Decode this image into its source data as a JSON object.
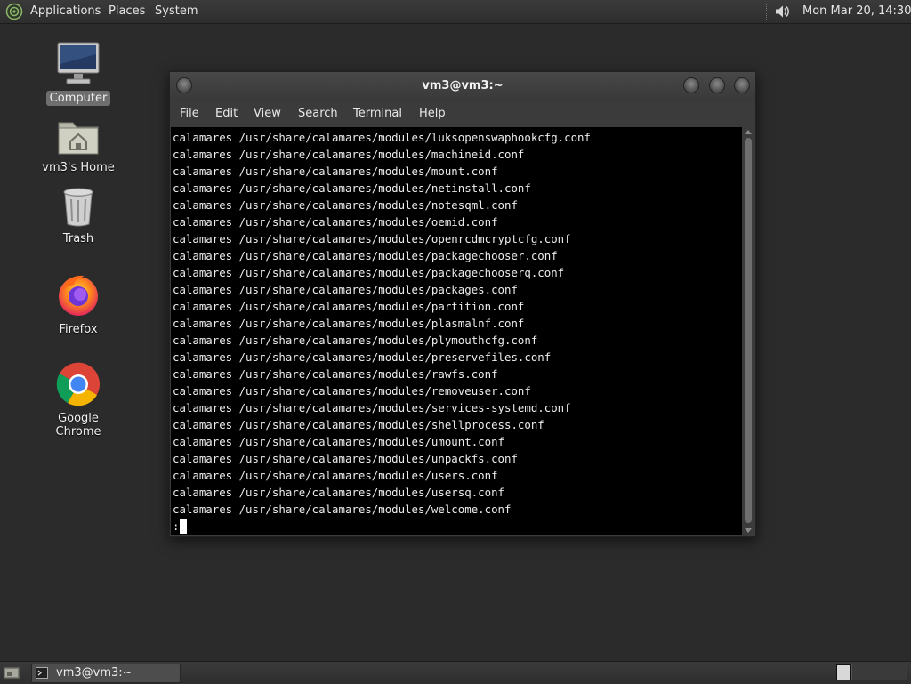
{
  "top_panel": {
    "menus": [
      "Applications",
      "Places",
      "System"
    ],
    "clock": "Mon Mar 20, 14:30"
  },
  "desktop": {
    "icons": [
      {
        "label": "Computer",
        "icon": "computer-icon"
      },
      {
        "label": "vm3's Home",
        "icon": "home-folder-icon"
      },
      {
        "label": "Trash",
        "icon": "trash-icon"
      },
      {
        "label": "Firefox",
        "icon": "firefox-icon"
      },
      {
        "label": "Google Chrome",
        "icon": "chrome-icon"
      }
    ]
  },
  "terminal": {
    "title": "vm3@vm3:~",
    "menu": [
      "File",
      "Edit",
      "View",
      "Search",
      "Terminal",
      "Help"
    ],
    "lines": [
      "calamares /usr/share/calamares/modules/luksopenswaphookcfg.conf",
      "calamares /usr/share/calamares/modules/machineid.conf",
      "calamares /usr/share/calamares/modules/mount.conf",
      "calamares /usr/share/calamares/modules/netinstall.conf",
      "calamares /usr/share/calamares/modules/notesqml.conf",
      "calamares /usr/share/calamares/modules/oemid.conf",
      "calamares /usr/share/calamares/modules/openrcdmcryptcfg.conf",
      "calamares /usr/share/calamares/modules/packagechooser.conf",
      "calamares /usr/share/calamares/modules/packagechooserq.conf",
      "calamares /usr/share/calamares/modules/packages.conf",
      "calamares /usr/share/calamares/modules/partition.conf",
      "calamares /usr/share/calamares/modules/plasmalnf.conf",
      "calamares /usr/share/calamares/modules/plymouthcfg.conf",
      "calamares /usr/share/calamares/modules/preservefiles.conf",
      "calamares /usr/share/calamares/modules/rawfs.conf",
      "calamares /usr/share/calamares/modules/removeuser.conf",
      "calamares /usr/share/calamares/modules/services-systemd.conf",
      "calamares /usr/share/calamares/modules/shellprocess.conf",
      "calamares /usr/share/calamares/modules/umount.conf",
      "calamares /usr/share/calamares/modules/unpackfs.conf",
      "calamares /usr/share/calamares/modules/users.conf",
      "calamares /usr/share/calamares/modules/usersq.conf",
      "calamares /usr/share/calamares/modules/welcome.conf",
      ":"
    ]
  },
  "taskbar": {
    "tasks": [
      {
        "label": "vm3@vm3:~",
        "icon": "terminal-icon"
      }
    ]
  }
}
